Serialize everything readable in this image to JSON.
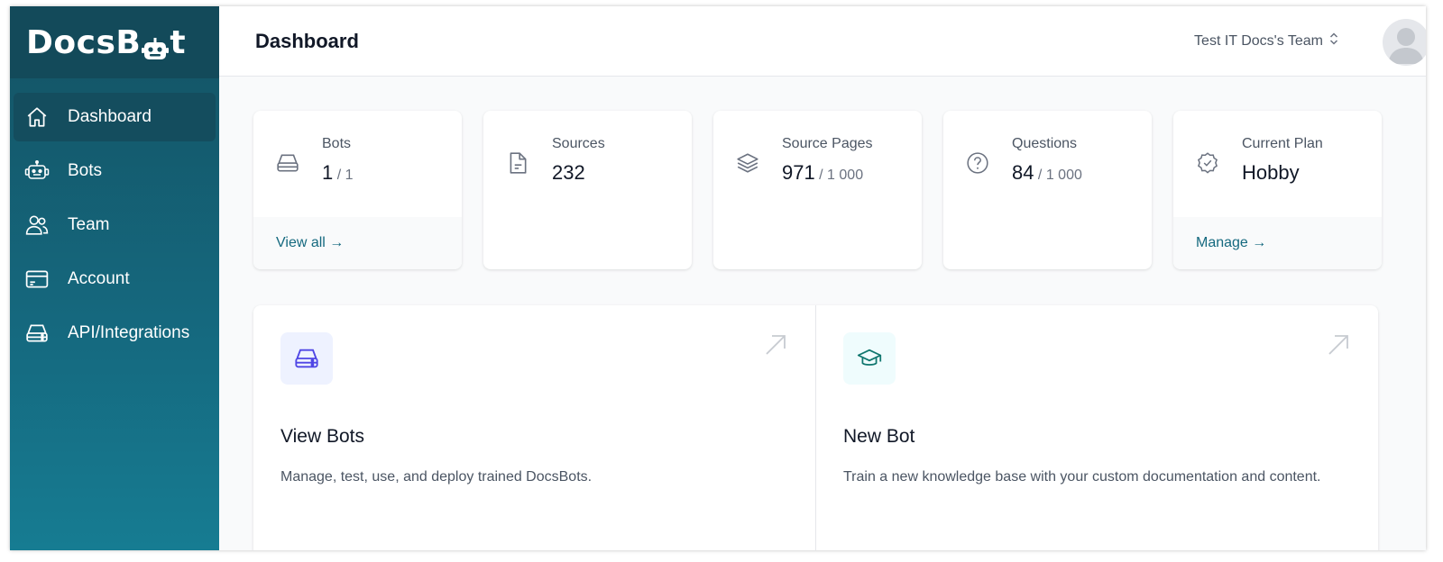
{
  "app": {
    "logo_text_left": "DocsB",
    "logo_text_right": "t"
  },
  "sidebar": {
    "items": [
      {
        "label": "Dashboard",
        "icon": "home-icon",
        "active": true
      },
      {
        "label": "Bots",
        "icon": "robot-icon",
        "active": false
      },
      {
        "label": "Team",
        "icon": "users-icon",
        "active": false
      },
      {
        "label": "Account",
        "icon": "credit-card-icon",
        "active": false
      },
      {
        "label": "API/Integrations",
        "icon": "server-icon",
        "active": false
      }
    ]
  },
  "header": {
    "title": "Dashboard",
    "team_name": "Test IT Docs's Team",
    "team_switch_icon": "chevron-up-down-icon",
    "avatar_icon": "user-avatar-icon"
  },
  "stats": [
    {
      "label": "Bots",
      "value": "1",
      "limit": " / 1",
      "icon": "server-icon",
      "link": "View all →"
    },
    {
      "label": "Sources",
      "value": "232",
      "limit": "",
      "icon": "document-icon",
      "link": ""
    },
    {
      "label": "Source Pages",
      "value": "971",
      "limit": " / 1 000",
      "icon": "layers-icon",
      "link": ""
    },
    {
      "label": "Questions",
      "value": "84",
      "limit": " / 1 000",
      "icon": "question-circle-icon",
      "link": ""
    },
    {
      "label": "Current Plan",
      "value": "Hobby",
      "limit": "",
      "icon": "check-badge-icon",
      "link": "Manage →"
    }
  ],
  "actions": [
    {
      "title": "View Bots",
      "description": "Manage, test, use, and deploy trained DocsBots.",
      "icon": "server-icon",
      "icon_color": "#4f46e5",
      "icon_bg": "#eef2ff"
    },
    {
      "title": "New Bot",
      "description": "Train a new knowledge base with your custom documentation and content.",
      "icon": "graduation-cap-icon",
      "icon_color": "#0f766e",
      "icon_bg": "#effcfd"
    }
  ],
  "colors": {
    "sidebar_top": "#134a5a",
    "sidebar_bottom": "#167c92",
    "link": "#15697f"
  }
}
